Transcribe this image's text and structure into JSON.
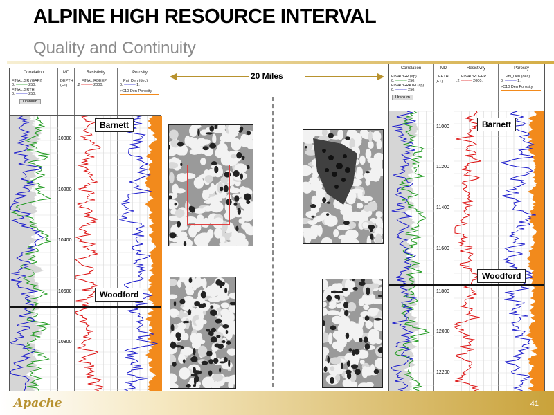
{
  "slide": {
    "title": "ALPINE HIGH RESOURCE INTERVAL",
    "subtitle": "Quality and Continuity",
    "distance_label": "20 Miles",
    "page_number": "41",
    "logo_text": "Apache"
  },
  "logs": {
    "headers": {
      "correlation": "Correlation",
      "md": "MD",
      "resistivity": "Resistivity",
      "porosity": "Porosity"
    },
    "left": {
      "gr_curve": "FINAL:GR (GAPI)",
      "gr_scale_min": "0.",
      "gr_scale_max": "250.",
      "grth_curve": "FINAL:GRTH",
      "grth_scale_min": "0.",
      "grth_scale_max": "250.",
      "uranium": "Uranium",
      "depth_label": "DEPTH",
      "depth_unit": "(FT)",
      "rdeep_curve": "FINAL:RDEEP",
      "rdeep_scale_min": ".2",
      "rdeep_scale_max": "2000.",
      "pni_curve": "Pni_Den (dec)",
      "pni_scale_min": "0.",
      "pni_scale_max": "1.",
      "den_porosity": ">C10 Den Porosity",
      "depths": [
        "10000",
        "10200",
        "10400",
        "10600",
        "10800"
      ]
    },
    "right": {
      "gr_curve": "FINAL:GR (ap)",
      "gr_scale_min": "0.",
      "gr_scale_max": "250.",
      "grth_curve": "FINAL:GRATH (ap)",
      "grth_scale_min": "0.",
      "grth_scale_max": "250.",
      "uranium": "Uranium",
      "depth_label": "DEPTH",
      "depth_unit": "(FT)",
      "rdeep_curve": "FINAL:RDEEP",
      "rdeep_scale_min": ".2",
      "rdeep_scale_max": "2000.",
      "pni_curve": "Pni_Den (dec)",
      "pni_scale_min": "0.",
      "pni_scale_max": "1.",
      "den_porosity": ">C10 Den Porosity",
      "depths": [
        "11000",
        "11200",
        "11400",
        "11600",
        "11800",
        "12000",
        "12200"
      ]
    }
  },
  "formations": {
    "left_upper": "Barnett",
    "left_lower": "Woodford",
    "right_upper": "Barnett",
    "right_lower": "Woodford"
  },
  "colors": {
    "gr": "#1f9a1f",
    "grth": "#1a1acc",
    "rdeep": "#dd1111",
    "porosity_fill": "#f28a1c",
    "accent": "#c9a23a",
    "arrow": "#b8922e"
  }
}
